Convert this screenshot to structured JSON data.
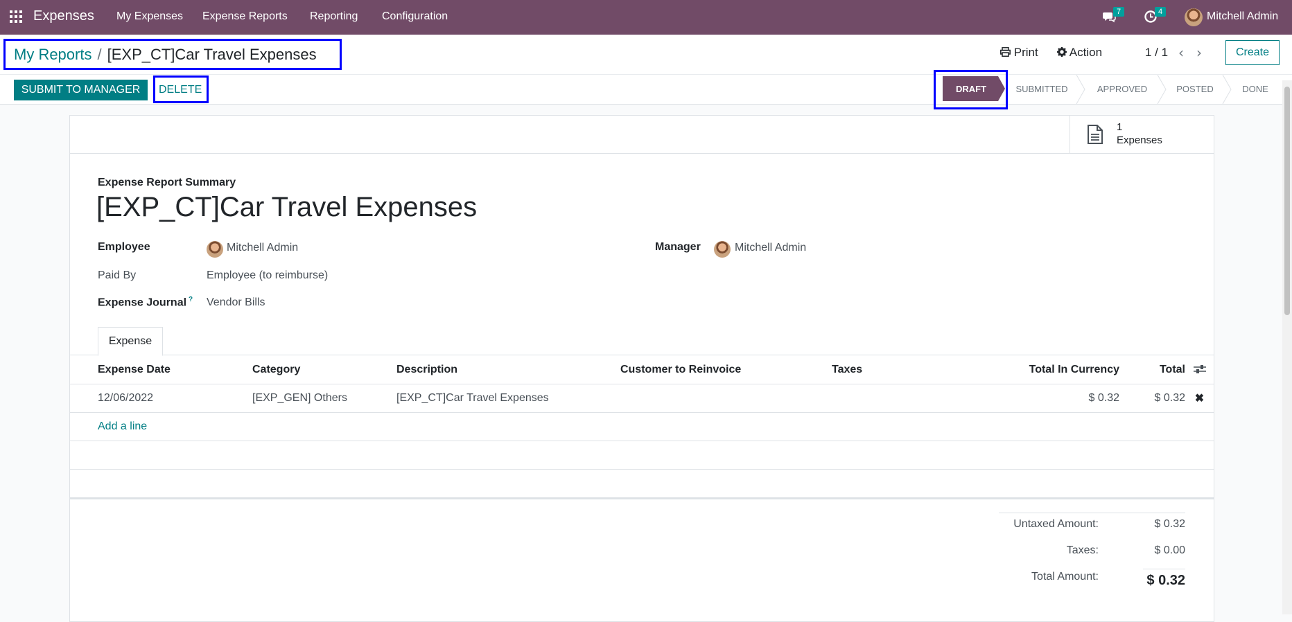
{
  "navbar": {
    "app_title": "Expenses",
    "menus": [
      "My Expenses",
      "Expense Reports",
      "Reporting",
      "Configuration"
    ],
    "messages_count": "7",
    "activities_count": "4",
    "user_name": "Mitchell Admin"
  },
  "breadcrumb": {
    "parent": "My Reports",
    "separator": "/",
    "current": "[EXP_CT]Car Travel Expenses"
  },
  "toolbar": {
    "print_label": "Print",
    "action_label": "Action",
    "pager": "1 / 1",
    "create_label": "Create",
    "submit_label": "SUBMIT TO MANAGER",
    "delete_label": "DELETE"
  },
  "statusbar": {
    "steps": [
      "DRAFT",
      "SUBMITTED",
      "APPROVED",
      "POSTED",
      "DONE"
    ],
    "active": "DRAFT"
  },
  "smart_button": {
    "count": "1",
    "label": "Expenses"
  },
  "form": {
    "summary_label": "Expense Report Summary",
    "title": "[EXP_CT]Car Travel Expenses",
    "employee_label": "Employee",
    "employee_value": "Mitchell Admin",
    "manager_label": "Manager",
    "manager_value": "Mitchell Admin",
    "paid_by_label": "Paid By",
    "paid_by_value": "Employee (to reimburse)",
    "journal_label": "Expense Journal",
    "journal_help": "?",
    "journal_value": "Vendor Bills"
  },
  "tabs": [
    "Expense"
  ],
  "table": {
    "columns": [
      "Expense Date",
      "Category",
      "Description",
      "Customer to Reinvoice",
      "Taxes",
      "Total In Currency",
      "Total"
    ],
    "rows": [
      [
        "12/06/2022",
        "[EXP_GEN] Others",
        "[EXP_CT]Car Travel Expenses",
        "",
        "",
        "$ 0.32",
        "$ 0.32"
      ]
    ],
    "add_line": "Add a line"
  },
  "totals": {
    "untaxed_label": "Untaxed Amount:",
    "untaxed_value": "$ 0.32",
    "taxes_label": "Taxes:",
    "taxes_value": "$ 0.00",
    "total_label": "Total Amount:",
    "total_value": "$ 0.32"
  },
  "colors": {
    "brand": "#714b67",
    "accent": "#017e84",
    "highlight": "#0000ff"
  }
}
